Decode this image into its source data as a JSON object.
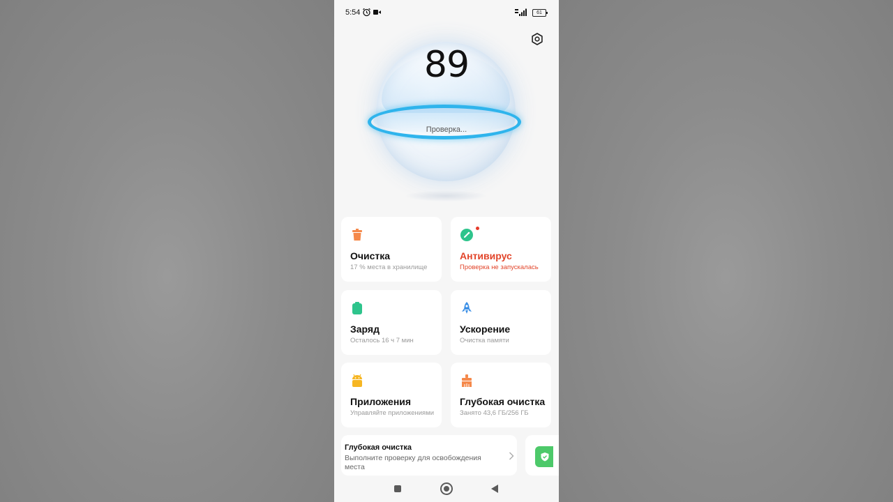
{
  "status_bar": {
    "time": "5:54",
    "battery": "61",
    "icons": [
      "alarm-icon",
      "video-icon",
      "signal-icon",
      "battery-icon"
    ]
  },
  "header": {
    "settings_icon": "gear-icon"
  },
  "score": {
    "value": "89",
    "status": "Проверка..."
  },
  "cards": [
    {
      "title": "Очистка",
      "subtitle": "17 % места в хранилище",
      "icon": "trash-icon",
      "color": "#f5894b"
    },
    {
      "title": "Антивирус",
      "subtitle": "Проверка не запускалась",
      "icon": "shield-check-icon",
      "color": "#2ec48c",
      "alert": true
    },
    {
      "title": "Заряд",
      "subtitle": "Осталось 16 ч 7 мин",
      "icon": "battery-icon",
      "color": "#2ec48c"
    },
    {
      "title": "Ускорение",
      "subtitle": "Очистка памяти",
      "icon": "rocket-icon",
      "color": "#3b8fe6"
    },
    {
      "title": "Приложения",
      "subtitle": "Управляйте приложениями",
      "icon": "android-icon",
      "color": "#f6b623"
    },
    {
      "title": "Глубокая очистка",
      "subtitle": "Занято 43,6 ГБ/256 ГБ",
      "icon": "brush-icon",
      "color": "#f5894b"
    }
  ],
  "banner": {
    "title": "Глубокая очистка",
    "subtitle": "Выполните проверку для освобождения места"
  },
  "colors": {
    "accent_ring": "#2fb4ec",
    "alert": "#e2452a"
  }
}
